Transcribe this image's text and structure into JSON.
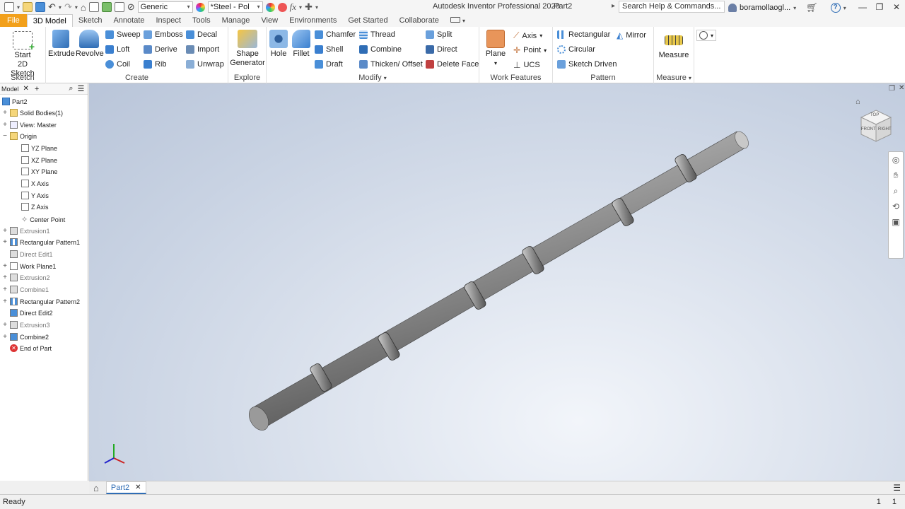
{
  "titlebar": {
    "material": "Generic",
    "appearance": "*Steel - Pol",
    "app_title": "Autodesk Inventor Professional 2020",
    "doc_title": "Part2",
    "search_placeholder": "Search Help & Commands...",
    "user": "boramollaogl..."
  },
  "tabs": [
    "File",
    "3D Model",
    "Sketch",
    "Annotate",
    "Inspect",
    "Tools",
    "Manage",
    "View",
    "Environments",
    "Get Started",
    "Collaborate"
  ],
  "ribbon": {
    "sketch": {
      "start": "Start",
      "start2": "2D Sketch",
      "label": "Sketch"
    },
    "create": {
      "extrude": "Extrude",
      "revolve": "Revolve",
      "sweep": "Sweep",
      "emboss": "Emboss",
      "decal": "Decal",
      "loft": "Loft",
      "derive": "Derive",
      "import": "Import",
      "coil": "Coil",
      "rib": "Rib",
      "unwrap": "Unwrap",
      "label": "Create"
    },
    "explore": {
      "shape1": "Shape",
      "shape2": "Generator",
      "label": "Explore"
    },
    "modify": {
      "hole": "Hole",
      "fillet": "Fillet",
      "chamfer": "Chamfer",
      "thread": "Thread",
      "split": "Split",
      "shell": "Shell",
      "combine": "Combine",
      "direct": "Direct",
      "draft": "Draft",
      "thicken": "Thicken/ Offset",
      "delete_face": "Delete Face",
      "label": "Modify"
    },
    "work_features": {
      "plane": "Plane",
      "axis": "Axis",
      "point": "Point",
      "ucs": "UCS",
      "label": "Work Features"
    },
    "pattern": {
      "rectangular": "Rectangular",
      "circular": "Circular",
      "sketch_driven": "Sketch Driven",
      "mirror": "Mirror",
      "label": "Pattern"
    },
    "measure": {
      "measure": "Measure",
      "label": "Measure"
    }
  },
  "browser": {
    "header": "Model",
    "root": "Part2",
    "items": [
      {
        "label": "Solid Bodies(1)",
        "dim": false
      },
      {
        "label": "View: Master",
        "dim": false
      },
      {
        "label": "Origin",
        "dim": false
      },
      {
        "label": "YZ Plane",
        "dim": false
      },
      {
        "label": "XZ Plane",
        "dim": false
      },
      {
        "label": "XY Plane",
        "dim": false
      },
      {
        "label": "X Axis",
        "dim": false
      },
      {
        "label": "Y Axis",
        "dim": false
      },
      {
        "label": "Z Axis",
        "dim": false
      },
      {
        "label": "Center Point",
        "dim": false
      },
      {
        "label": "Extrusion1",
        "dim": true
      },
      {
        "label": "Rectangular Pattern1",
        "dim": false
      },
      {
        "label": "Direct Edit1",
        "dim": true
      },
      {
        "label": "Work Plane1",
        "dim": false
      },
      {
        "label": "Extrusion2",
        "dim": true
      },
      {
        "label": "Combine1",
        "dim": true
      },
      {
        "label": "Rectangular Pattern2",
        "dim": false
      },
      {
        "label": "Direct Edit2",
        "dim": false
      },
      {
        "label": "Extrusion3",
        "dim": true
      },
      {
        "label": "Combine2",
        "dim": false
      },
      {
        "label": "End of Part",
        "dim": false
      }
    ]
  },
  "doc_tab": "Part2",
  "status": {
    "left": "Ready",
    "right1": "1",
    "right2": "1"
  },
  "viewcube": {
    "top": "TOP",
    "front": "FRONT",
    "right": "RIGHT"
  }
}
